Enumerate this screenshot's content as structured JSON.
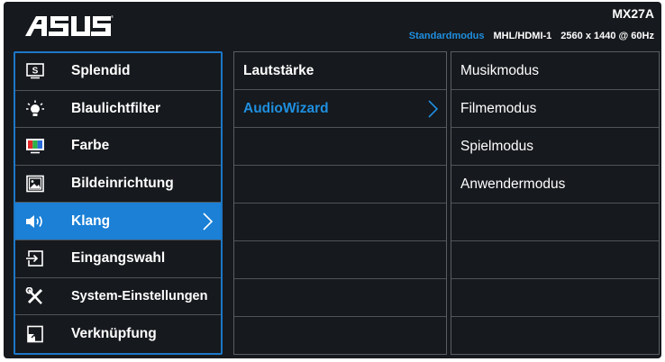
{
  "header": {
    "logo_text": "ASUS",
    "model": "MX27A",
    "mode": "Standardmodus",
    "input": "MHL/HDMI-1",
    "resolution": "2560 x 1440 @ 60Hz"
  },
  "menu": {
    "items": [
      {
        "label": "Splendid",
        "icon": "splendid-icon"
      },
      {
        "label": "Blaulichtfilter",
        "icon": "bluelight-icon"
      },
      {
        "label": "Farbe",
        "icon": "color-icon"
      },
      {
        "label": "Bildeinrichtung",
        "icon": "image-icon"
      },
      {
        "label": "Klang",
        "icon": "speaker-icon",
        "selected": true
      },
      {
        "label": "Eingangswahl",
        "icon": "input-icon"
      },
      {
        "label": "System-Einstellungen",
        "icon": "tools-icon"
      },
      {
        "label": "Verknüpfung",
        "icon": "shortcut-icon"
      }
    ]
  },
  "submenu": {
    "items": [
      "Lautstärke",
      "AudioWizard",
      "",
      "",
      "",
      "",
      "",
      ""
    ],
    "active_index": 1
  },
  "options": {
    "items": [
      "Musikmodus",
      "Filmemodus",
      "Spielmodus",
      "Anwendermodus",
      "",
      "",
      "",
      ""
    ]
  },
  "colors": {
    "accent": "#1b80d6",
    "background": "#16191d",
    "highlight_text": "#1f8fe0"
  }
}
